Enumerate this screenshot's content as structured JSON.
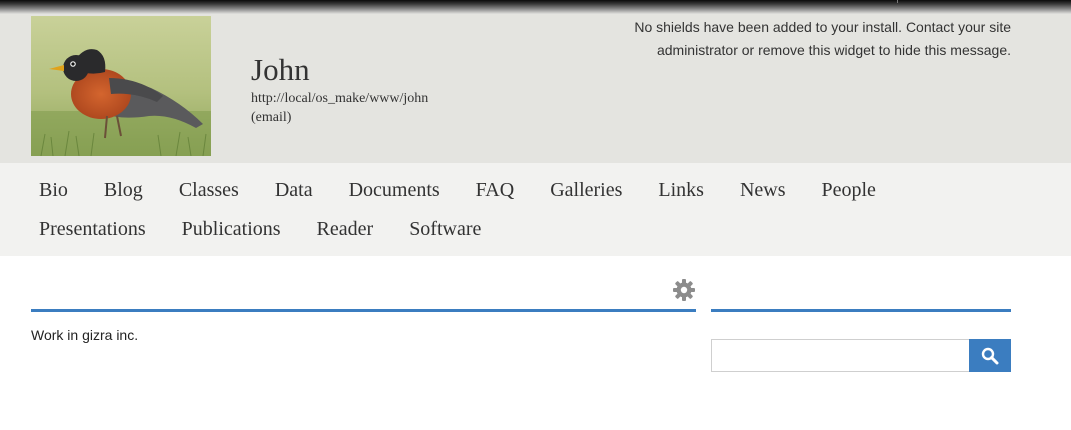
{
  "header": {
    "name": "John",
    "url": "http://local/os_make/www/john",
    "email": "(email)",
    "shields_notice": "No shields have been added to your install. Contact your site administrator or remove this widget to hide this message."
  },
  "nav": {
    "row1": [
      "Bio",
      "Blog",
      "Classes",
      "Data",
      "Documents",
      "FAQ",
      "Galleries",
      "Links",
      "News",
      "People"
    ],
    "row2": [
      "Presentations",
      "Publications",
      "Reader",
      "Software"
    ]
  },
  "content": {
    "text": "Work in gizra inc."
  },
  "search": {
    "value": "",
    "placeholder": ""
  },
  "icons": {
    "settings": "gear-icon",
    "search": "search-icon"
  },
  "colors": {
    "accent": "#3b7dc0",
    "header_bg": "#e4e4e0",
    "nav_bg": "#f2f2f0",
    "gear": "#8c8c8c"
  }
}
